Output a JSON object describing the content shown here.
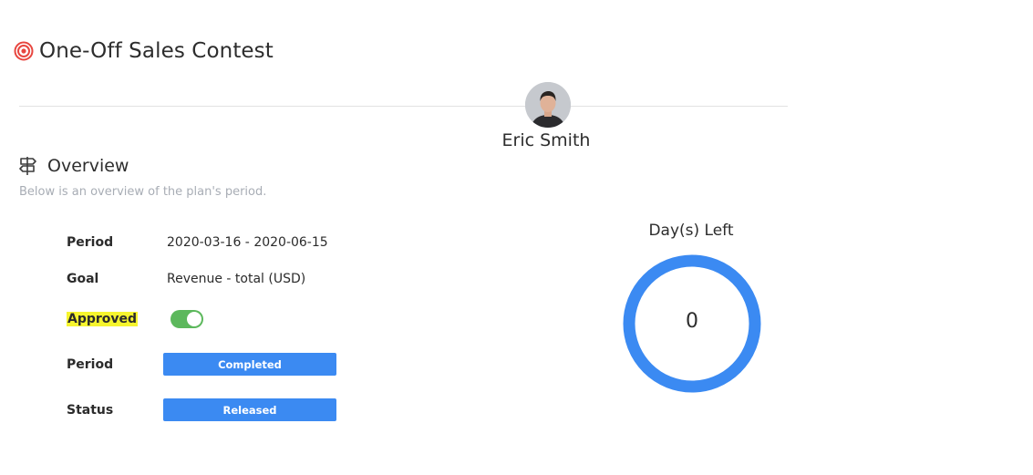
{
  "header": {
    "title": "One-Off Sales Contest",
    "title_icon": "target-icon",
    "accent_color": "#e8463f"
  },
  "user": {
    "name": "Eric Smith",
    "avatar_icon": "avatar"
  },
  "overview": {
    "title": "Overview",
    "icon": "signpost-icon",
    "subtitle": "Below is an overview of the plan's period.",
    "rows": [
      {
        "label": "Period",
        "value": "2020-03-16 - 2020-06-15"
      },
      {
        "label": "Goal",
        "value": "Revenue - total (USD)"
      },
      {
        "label": "Approved",
        "value": true
      },
      {
        "label": "Period",
        "value": "Completed"
      },
      {
        "label": "Status",
        "value": "Released"
      }
    ]
  },
  "days_left": {
    "title": "Day(s) Left",
    "value": "0",
    "ring_color": "#3b8af2"
  },
  "colors": {
    "badge": "#3b8af2",
    "toggle_on": "#5cb85c",
    "highlight": "#f6f52e"
  }
}
